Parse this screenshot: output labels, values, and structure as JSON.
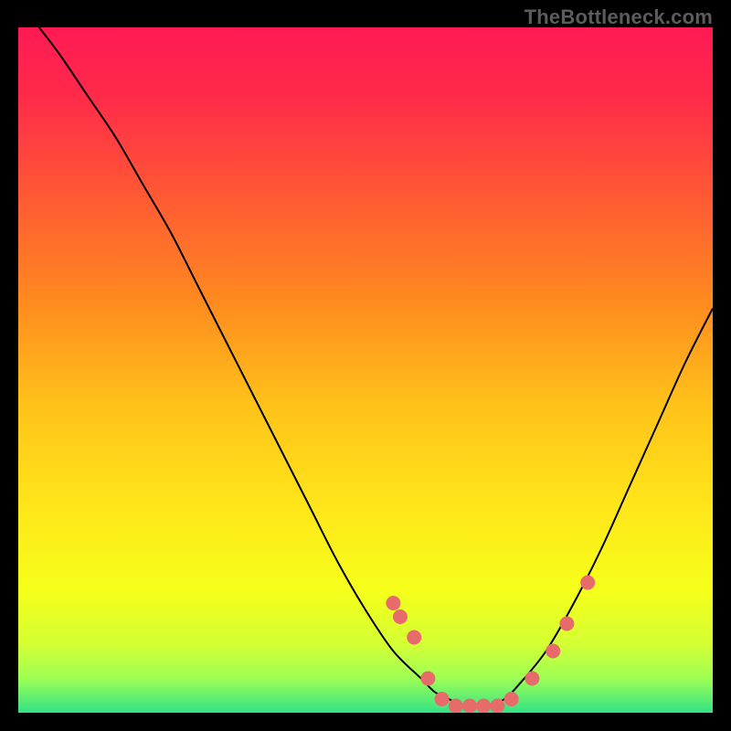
{
  "watermark": "TheBottleneck.com",
  "chart_data": {
    "type": "line",
    "title": "",
    "xlabel": "",
    "ylabel": "",
    "xlim": [
      0,
      100
    ],
    "ylim": [
      0,
      100
    ],
    "grid": false,
    "legend": false,
    "gradient_stops": [
      {
        "offset": 0.0,
        "color": "#ff1a53"
      },
      {
        "offset": 0.1,
        "color": "#ff2a4a"
      },
      {
        "offset": 0.25,
        "color": "#ff5a33"
      },
      {
        "offset": 0.4,
        "color": "#ff8a1f"
      },
      {
        "offset": 0.55,
        "color": "#ffc21a"
      },
      {
        "offset": 0.7,
        "color": "#ffe61a"
      },
      {
        "offset": 0.82,
        "color": "#f6ff1a"
      },
      {
        "offset": 0.9,
        "color": "#d4ff33"
      },
      {
        "offset": 0.95,
        "color": "#9dff55"
      },
      {
        "offset": 1.0,
        "color": "#33e286"
      }
    ],
    "series": [
      {
        "name": "bottleneck-curve",
        "color": "#000000",
        "x": [
          3,
          6,
          10,
          14,
          18,
          22,
          26,
          30,
          34,
          38,
          42,
          46,
          50,
          54,
          58,
          60,
          62,
          64,
          66,
          68,
          70,
          72,
          76,
          80,
          84,
          88,
          92,
          96,
          100
        ],
        "y": [
          100,
          96,
          90,
          84,
          77,
          70,
          62,
          54,
          46,
          38,
          30,
          22,
          15,
          9,
          5,
          3,
          2,
          1,
          1,
          1,
          2,
          4,
          9,
          16,
          24,
          33,
          42,
          51,
          59
        ]
      }
    ],
    "markers": {
      "name": "highlight-dots",
      "color": "#e76b6b",
      "radius": 8,
      "points": [
        {
          "x": 54,
          "y": 16
        },
        {
          "x": 55,
          "y": 14
        },
        {
          "x": 57,
          "y": 11
        },
        {
          "x": 59,
          "y": 5
        },
        {
          "x": 61,
          "y": 2
        },
        {
          "x": 63,
          "y": 1
        },
        {
          "x": 65,
          "y": 1
        },
        {
          "x": 67,
          "y": 1
        },
        {
          "x": 69,
          "y": 1
        },
        {
          "x": 71,
          "y": 2
        },
        {
          "x": 74,
          "y": 5
        },
        {
          "x": 77,
          "y": 9
        },
        {
          "x": 79,
          "y": 13
        },
        {
          "x": 82,
          "y": 19
        }
      ]
    }
  }
}
